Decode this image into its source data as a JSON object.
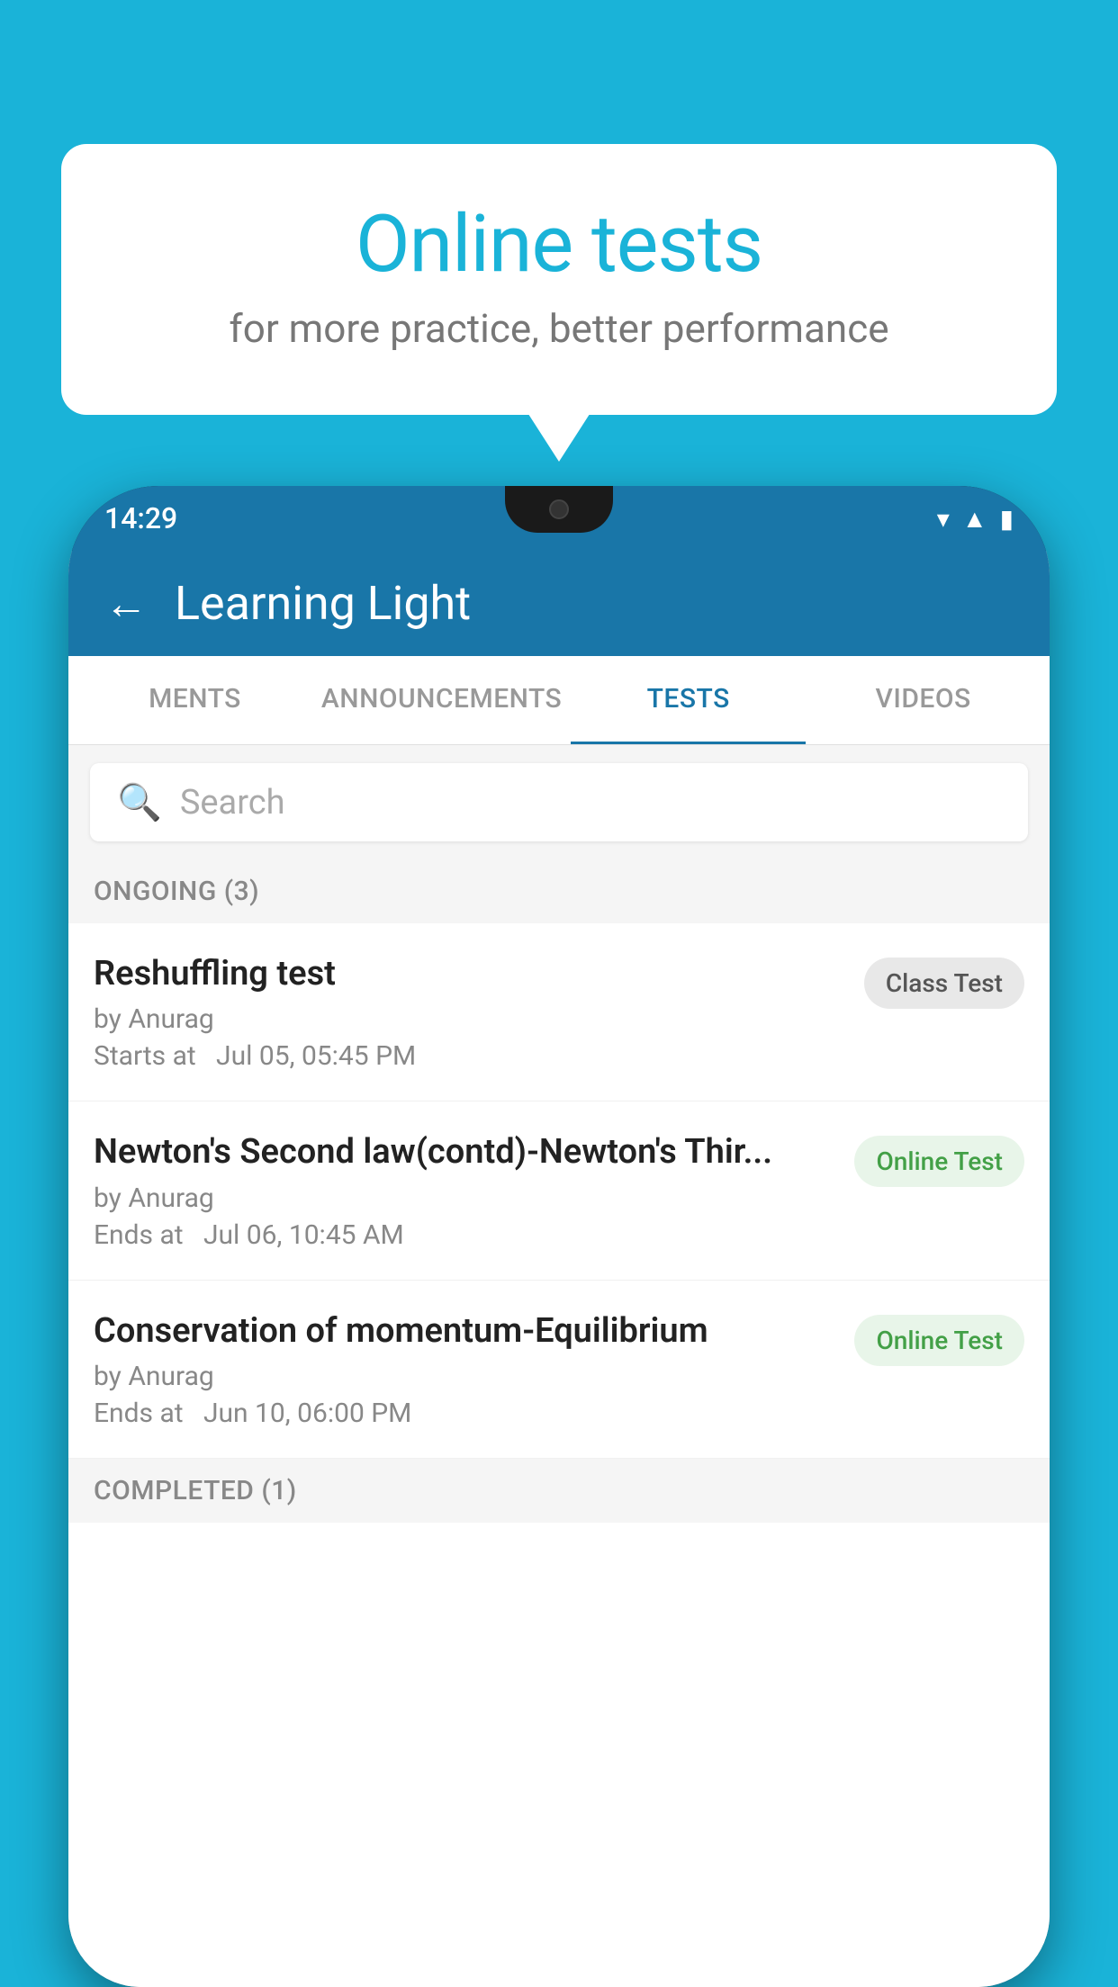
{
  "background_color": "#1ab3d8",
  "speech_bubble": {
    "title": "Online tests",
    "subtitle": "for more practice, better performance"
  },
  "phone": {
    "status_bar": {
      "time": "14:29",
      "icons": [
        "wifi",
        "signal",
        "battery"
      ]
    },
    "header": {
      "title": "Learning Light",
      "back_label": "←"
    },
    "tabs": [
      {
        "label": "MENTS",
        "active": false
      },
      {
        "label": "ANNOUNCEMENTS",
        "active": false
      },
      {
        "label": "TESTS",
        "active": true
      },
      {
        "label": "VIDEOS",
        "active": false
      }
    ],
    "search": {
      "placeholder": "Search"
    },
    "ongoing_section": {
      "label": "ONGOING (3)"
    },
    "test_items": [
      {
        "name": "Reshuffling test",
        "author": "by Anurag",
        "time_label": "Starts at",
        "time": "Jul 05, 05:45 PM",
        "badge": "Class Test",
        "badge_type": "class"
      },
      {
        "name": "Newton's Second law(contd)-Newton's Thir...",
        "author": "by Anurag",
        "time_label": "Ends at",
        "time": "Jul 06, 10:45 AM",
        "badge": "Online Test",
        "badge_type": "online"
      },
      {
        "name": "Conservation of momentum-Equilibrium",
        "author": "by Anurag",
        "time_label": "Ends at",
        "time": "Jun 10, 06:00 PM",
        "badge": "Online Test",
        "badge_type": "online"
      }
    ],
    "completed_section": {
      "label": "COMPLETED (1)"
    }
  }
}
